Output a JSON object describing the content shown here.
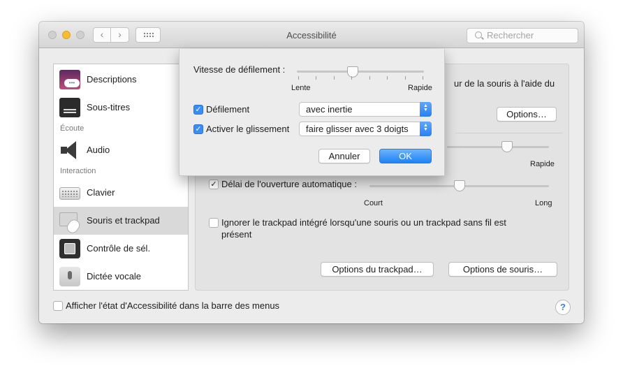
{
  "window": {
    "title": "Accessibilité"
  },
  "toolbar": {
    "back_glyph": "‹",
    "forward_glyph": "›",
    "grid_icon": "grid-icon"
  },
  "search": {
    "placeholder": "Rechercher"
  },
  "sidebar": {
    "items": [
      {
        "label": "Descriptions",
        "icon": "descriptions-icon"
      },
      {
        "label": "Sous-titres",
        "icon": "subtitles-icon"
      },
      {
        "category": "Écoute"
      },
      {
        "label": "Audio",
        "icon": "speaker-icon"
      },
      {
        "category": "Interaction"
      },
      {
        "label": "Clavier",
        "icon": "keyboard-icon"
      },
      {
        "label": "Souris et trackpad",
        "icon": "mouse-trackpad-icon",
        "selected": true
      },
      {
        "label": "Contrôle de sél.",
        "icon": "switch-control-icon"
      },
      {
        "label": "Dictée vocale",
        "icon": "microphone-icon"
      }
    ]
  },
  "panel": {
    "partial_text": "ur de la souris à l'aide du",
    "options_button": "Options…",
    "speed_rapide": "Rapide",
    "spring_loading": {
      "checked": true,
      "label": "Délai de l'ouverture automatique :",
      "min_label": "Court",
      "max_label": "Long",
      "value_fraction": 0.5
    },
    "ignore_trackpad": {
      "checked": false,
      "label_line1": "Ignorer le trackpad intégré lorsqu'une souris ou un trackpad sans fil est",
      "label_line2": "présent"
    },
    "trackpad_options_button": "Options du trackpad…",
    "mouse_options_button": "Options de souris…",
    "speed_value_fraction": 0.59
  },
  "footer": {
    "show_status_checked": false,
    "show_status_label": "Afficher l'état d'Accessibilité dans la barre des menus",
    "help_label": "?"
  },
  "sheet": {
    "scroll_speed": {
      "label": "Vitesse de défilement :",
      "min_label": "Lente",
      "max_label": "Rapide",
      "value_fraction": 0.44
    },
    "scrolling": {
      "checked": true,
      "label": "Défilement",
      "selected_option": "avec inertie"
    },
    "dragging": {
      "checked": true,
      "label": "Activer le glissement",
      "selected_option": "faire glisser avec 3 doigts"
    },
    "cancel_button": "Annuler",
    "ok_button": "OK",
    "accent_color": "#1d82f5"
  }
}
